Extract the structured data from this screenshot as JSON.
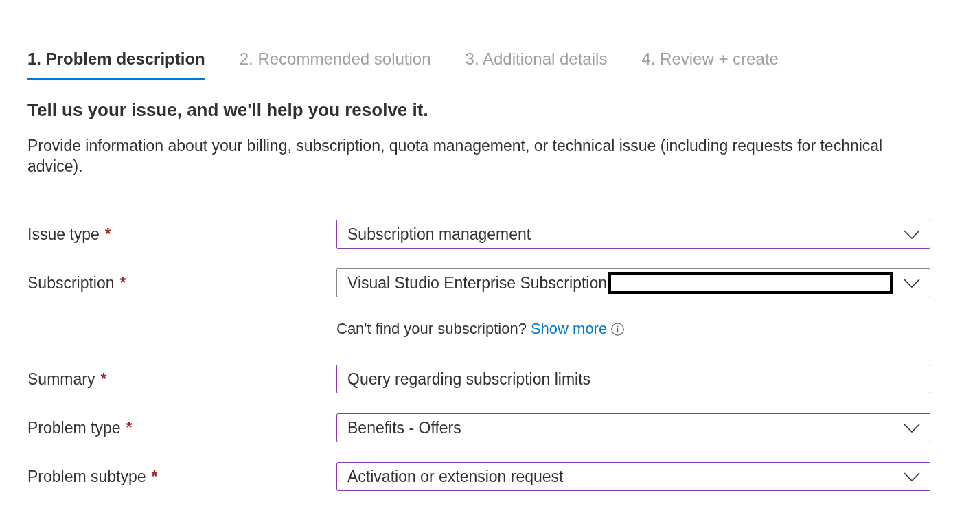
{
  "tabs": [
    {
      "label": "1. Problem description",
      "selected": true
    },
    {
      "label": "2. Recommended solution",
      "selected": false
    },
    {
      "label": "3. Additional details",
      "selected": false
    },
    {
      "label": "4. Review + create",
      "selected": false
    }
  ],
  "heading": "Tell us your issue, and we'll help you resolve it.",
  "description": "Provide information about your billing, subscription, quota management, or technical issue (including requests for technical advice).",
  "form": {
    "fields": [
      {
        "label": "Issue type",
        "required_mark": "*",
        "kind": "dropdown",
        "value": "Subscription management",
        "modified": true,
        "redacted": false
      },
      {
        "label": "Subscription",
        "required_mark": "*",
        "kind": "dropdown",
        "value": "Visual Studio Enterprise Subscription",
        "modified": false,
        "redacted": true,
        "help": {
          "text": "Can't find your subscription?",
          "link": "Show more"
        }
      },
      {
        "label": "Summary",
        "required_mark": "*",
        "kind": "text",
        "value": "Query regarding subscription limits",
        "modified": true,
        "redacted": false
      },
      {
        "label": "Problem type",
        "required_mark": "*",
        "kind": "dropdown",
        "value": "Benefits - Offers",
        "modified": true,
        "redacted": false
      },
      {
        "label": "Problem subtype",
        "required_mark": "*",
        "kind": "dropdown",
        "value": "Activation or extension request",
        "modified": true,
        "redacted": false
      }
    ]
  }
}
